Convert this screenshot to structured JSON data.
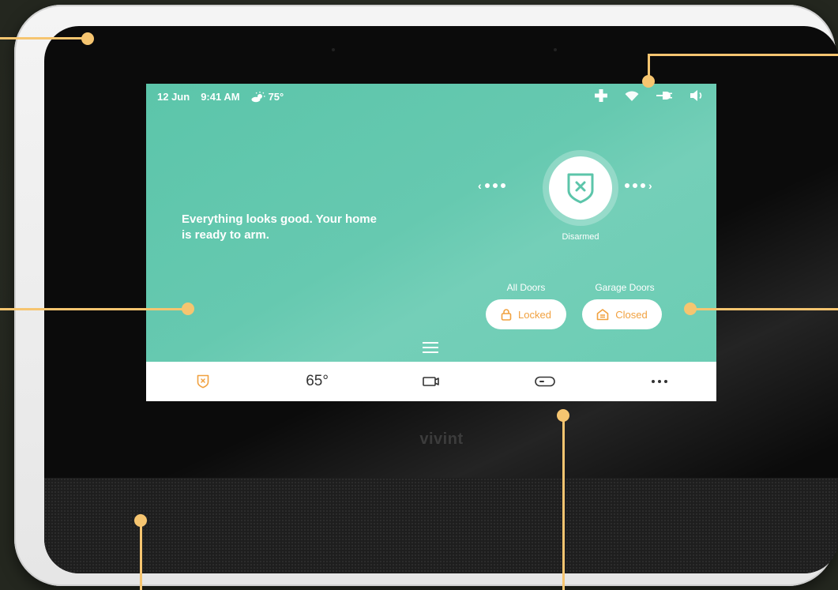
{
  "status_bar": {
    "date": "12 Jun",
    "time": "9:41 AM",
    "temperature": "75°",
    "icons": [
      "medical-cross-icon",
      "wifi-icon",
      "power-plug-icon",
      "speaker-icon"
    ]
  },
  "main": {
    "message": "Everything looks good. Your home is ready to arm.",
    "arm_state": "Disarmed",
    "arm_icon": "shield-x-icon"
  },
  "shortcuts": [
    {
      "label": "All Doors",
      "status": "Locked",
      "icon": "lock-icon"
    },
    {
      "label": "Garage Doors",
      "status": "Closed",
      "icon": "garage-icon"
    }
  ],
  "bottom_nav": {
    "security_icon": "shield-x-icon",
    "thermostat": "65°",
    "camera_icon": "camera-icon",
    "smart_home_icon": "device-icon",
    "more_icon": "more-icon"
  },
  "brand": "vivint",
  "colors": {
    "screen": "#66c9b0",
    "accent": "#f1a13f",
    "callout": "#f6c570",
    "bezel": "#0b0b0b"
  }
}
